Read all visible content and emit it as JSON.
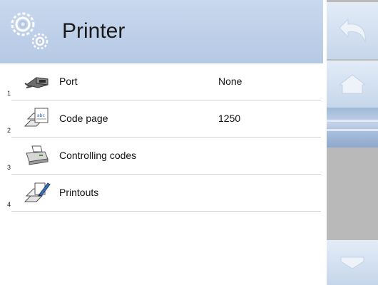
{
  "header": {
    "title": "Printer",
    "icon": "gears-icon"
  },
  "items": [
    {
      "number": "1",
      "label": "Port",
      "value": "None",
      "icon": "port-connector-icon"
    },
    {
      "number": "2",
      "label": "Code page",
      "value": "1250",
      "icon": "code-page-document-icon"
    },
    {
      "number": "3",
      "label": "Controlling codes",
      "value": "",
      "icon": "printer-icon"
    },
    {
      "number": "4",
      "label": "Printouts",
      "value": "",
      "icon": "printouts-edit-icon"
    }
  ],
  "sidebar": {
    "back_icon": "undo-arrow-icon",
    "home_icon": "home-icon",
    "down_icon": "down-arrow-icon"
  },
  "colors": {
    "header_bg": "#bccde6",
    "sidebar_bg": "#b9b9b9",
    "button_bg": "#d6e2f1"
  }
}
